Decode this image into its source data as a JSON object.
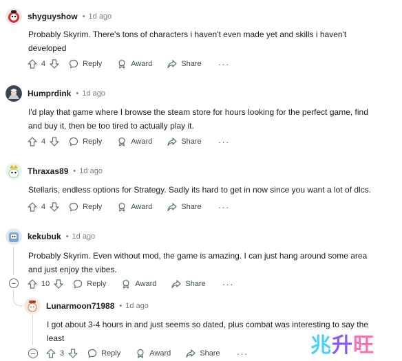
{
  "comments": [
    {
      "username": "shyguyshow",
      "time": "1d ago",
      "body": "Probably Skyrim. There's tons of characters i haven't even made yet and skills i haven't developed",
      "votes": "4",
      "reply_label": "Reply",
      "award_label": "Award",
      "share_label": "Share",
      "more_label": "···"
    },
    {
      "username": "Humprdink",
      "time": "1d ago",
      "body": "I'd play that game where I browse the steam store for hours looking for the perfect game, find and buy it, then be too tired to actually play it.",
      "votes": "4",
      "reply_label": "Reply",
      "award_label": "Award",
      "share_label": "Share",
      "more_label": "···"
    },
    {
      "username": "Thraxas89",
      "time": "1d ago",
      "body": "Stellaris, endless options for Strategy. Sadly its hard to get in now since you want a lot of dlcs.",
      "votes": "4",
      "reply_label": "Reply",
      "award_label": "Award",
      "share_label": "Share",
      "more_label": "···"
    },
    {
      "username": "kekubuk",
      "time": "1d ago",
      "body": "Probably Skyrim. Even without mod, the game is amazing. I can just hang around some area and just enjoy the vibes.",
      "votes": "10",
      "reply_label": "Reply",
      "award_label": "Award",
      "share_label": "Share",
      "more_label": "···"
    },
    {
      "username": "Lunarmoon71988",
      "time": "1d ago",
      "body": "I got about 3-4 hours in and just seems so dated, plus combat was interesting to say the least",
      "votes": "3",
      "reply_label": "Reply",
      "award_label": "Award",
      "share_label": "Share",
      "more_label": "···"
    }
  ],
  "separator": "•",
  "watermark": {
    "c1": "兆",
    "c2": "升",
    "c3": "旺"
  },
  "colors": {
    "meta": "#7c7c7c",
    "action": "#576f76",
    "thread": "#d4d9dc"
  }
}
